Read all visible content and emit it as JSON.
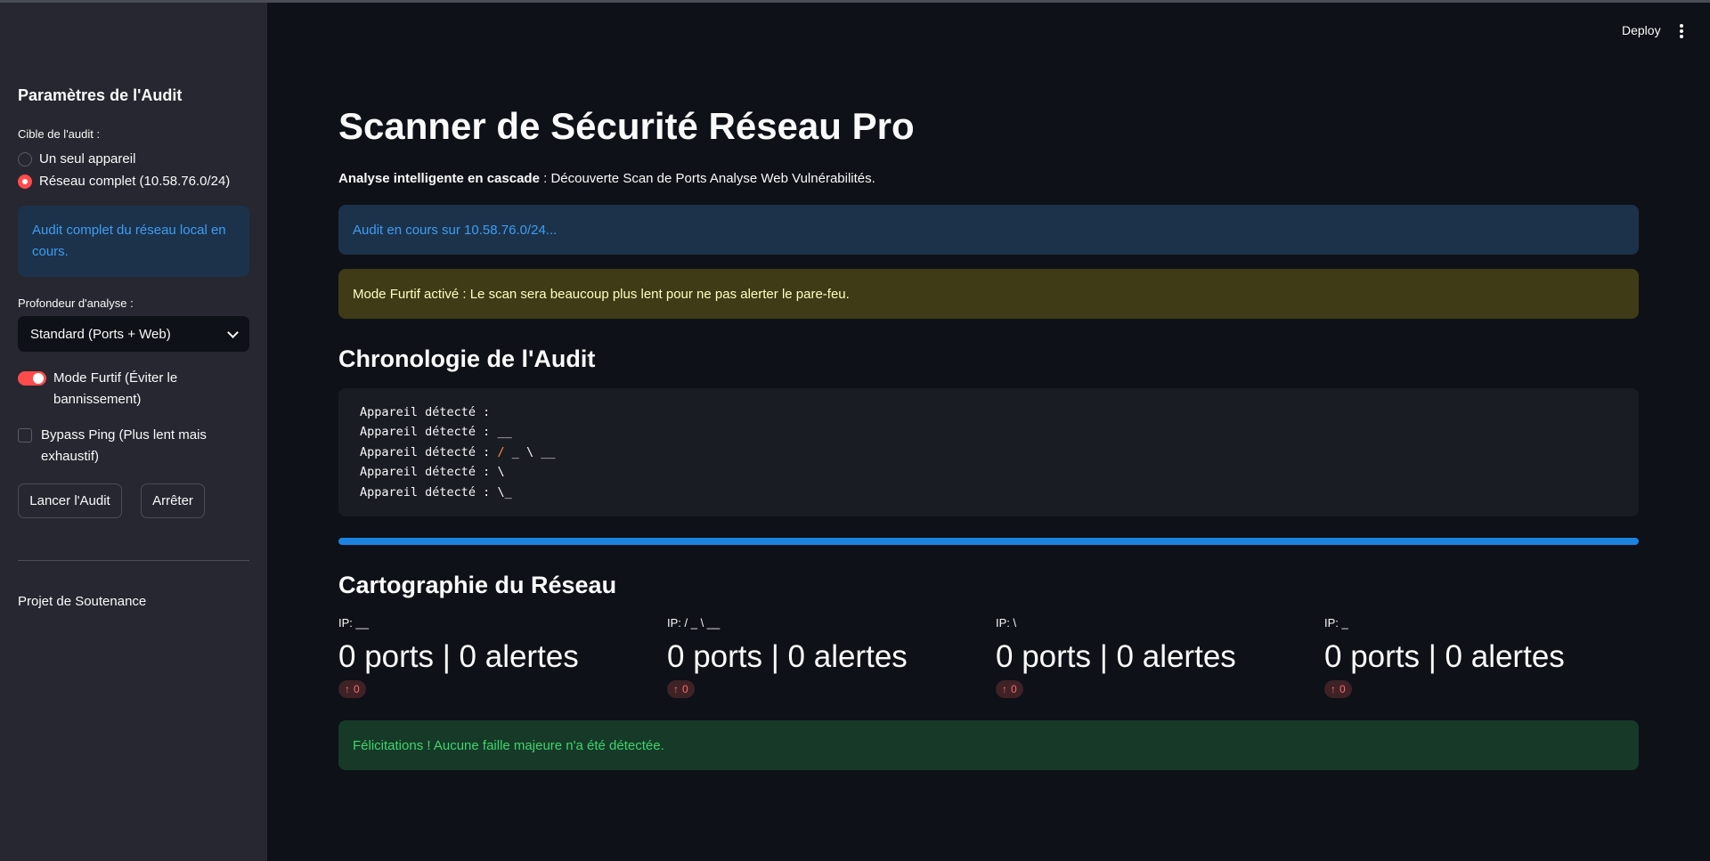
{
  "sidebar": {
    "title": "Paramètres de l'Audit",
    "target_label": "Cible de l'audit :",
    "target_options": [
      "Un seul appareil",
      "Réseau complet (10.58.76.0/24)"
    ],
    "target_selected": "Réseau complet (10.58.76.0/24)",
    "info_message": "Audit complet du réseau local en cours.",
    "depth_label": "Profondeur d'analyse :",
    "depth_value": "Standard (Ports + Web)",
    "stealth_label": "Mode Furtif (Éviter le bannissement)",
    "stealth_on": true,
    "bypass_label": "Bypass Ping (Plus lent mais exhaustif)",
    "bypass_on": false,
    "start_button": "Lancer l'Audit",
    "stop_button": "Arrêter",
    "footer": "Projet de Soutenance"
  },
  "header": {
    "deploy_label": "Deploy",
    "menu_icon": "kebab-menu-icon"
  },
  "main": {
    "title": "Scanner de Sécurité Réseau Pro",
    "subtitle_bold": "Analyse intelligente en cascade",
    "subtitle_rest": " : Découverte Scan de Ports Analyse Web Vulnérabilités.",
    "info_alert": "Audit en cours sur 10.58.76.0/24...",
    "warning_alert": "Mode Furtif activé : Le scan sera beaucoup plus lent pour ne pas alerter le pare-feu.",
    "timeline_heading": "Chronologie de l'Audit",
    "log_prefix": "Appareil détecté :",
    "log_lines": [
      {
        "prefix": "Appareil détecté :",
        "highlight": "",
        "rest": ""
      },
      {
        "prefix": "Appareil détecté :",
        "highlight": "",
        "rest": "__"
      },
      {
        "prefix": "Appareil détecté :",
        "highlight": "/",
        "rest": " _ \\ __"
      },
      {
        "prefix": "Appareil détecté :",
        "highlight": "",
        "rest": "\\"
      },
      {
        "prefix": "Appareil détecté :",
        "highlight": "",
        "rest": "\\_"
      }
    ],
    "progress": 1.0,
    "map_heading": "Cartographie du Réseau",
    "metrics": [
      {
        "label": "IP: __",
        "value": "0 ports | 0 alertes",
        "delta": "0"
      },
      {
        "label": "IP: / _ \\ __",
        "value": "0 ports | 0 alertes",
        "delta": "0"
      },
      {
        "label": "IP: \\",
        "value": "0 ports | 0 alertes",
        "delta": "0"
      },
      {
        "label": "IP: _",
        "value": "0 ports | 0 alertes",
        "delta": "0"
      }
    ],
    "success_alert": "Félicitations ! Aucune faille majeure n'a été détectée."
  },
  "colors": {
    "accent": "#ff4b4b",
    "info": "#3d9df3",
    "success": "#3dd56d",
    "progress": "#1c83e1"
  }
}
